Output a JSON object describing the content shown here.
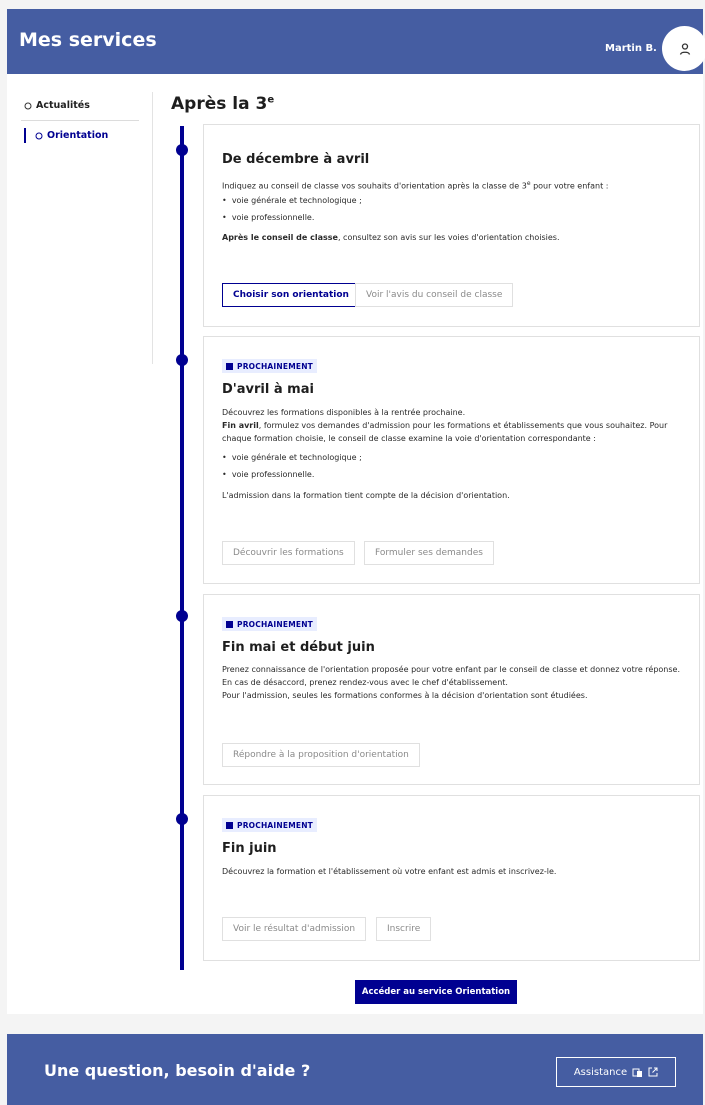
{
  "header": {
    "title": "Mes services",
    "user_name": "Martin B."
  },
  "sidebar": {
    "items": [
      {
        "label": "Actualités",
        "icon": "circle-icon"
      },
      {
        "label": "Orientation",
        "icon": "circle-icon",
        "active": true
      }
    ]
  },
  "page": {
    "title": "Après la 3",
    "title_sup": "e"
  },
  "cards": [
    {
      "title": "De décembre à avril",
      "intro": "Indiquez au conseil de classe vos souhaits d'orientation après la classe de 3",
      "intro_sup": "e",
      "intro_end": " pour votre enfant :",
      "bullets": [
        "voie générale et technologique ;",
        "voie professionnelle."
      ],
      "after_bold": "Après le conseil de classe",
      "after_rest": ", consultez son avis sur les voies d'orientation choisies.",
      "buttons": [
        "Choisir son orientation",
        "Voir l'avis du conseil de classe"
      ]
    },
    {
      "badge": "PROCHAINEMENT",
      "title": "D'avril à mai",
      "line1": "Découvrez les formations disponibles à la rentrée prochaine.",
      "line2_bold": "Fin avril",
      "line2_rest": ", formulez vos demandes d'admission pour les formations et établissements que vous souhaitez. Pour",
      "line3": "chaque formation choisie, le conseil de classe examine la voie d'orientation correspondante :",
      "bullets": [
        "voie générale et technologique ;",
        "voie professionnelle."
      ],
      "line4": "L'admission dans la formation tient compte de la décision d'orientation.",
      "buttons": [
        "Découvrir les formations",
        "Formuler ses demandes"
      ]
    },
    {
      "badge": "PROCHAINEMENT",
      "title": "Fin mai et début juin",
      "line1": "Prenez connaissance de l'orientation proposée pour votre enfant par le conseil de classe et donnez votre réponse.",
      "line2": "En cas de désaccord, prenez rendez-vous avec le chef d'établissement.",
      "line3": "Pour l'admission, seules les formations conformes à la décision d'orientation sont étudiées.",
      "buttons": [
        "Répondre à la proposition d'orientation"
      ]
    },
    {
      "badge": "PROCHAINEMENT",
      "title": "Fin juin",
      "line1": "Découvrez la formation et l'établissement où votre enfant est admis et inscrivez-le.",
      "buttons": [
        "Voir le résultat d'admission",
        "Inscrire"
      ]
    }
  ],
  "cta": "Accéder au service Orientation",
  "footer": {
    "question": "Une question, besoin d'aide ?",
    "assist_label": "Assistance"
  }
}
